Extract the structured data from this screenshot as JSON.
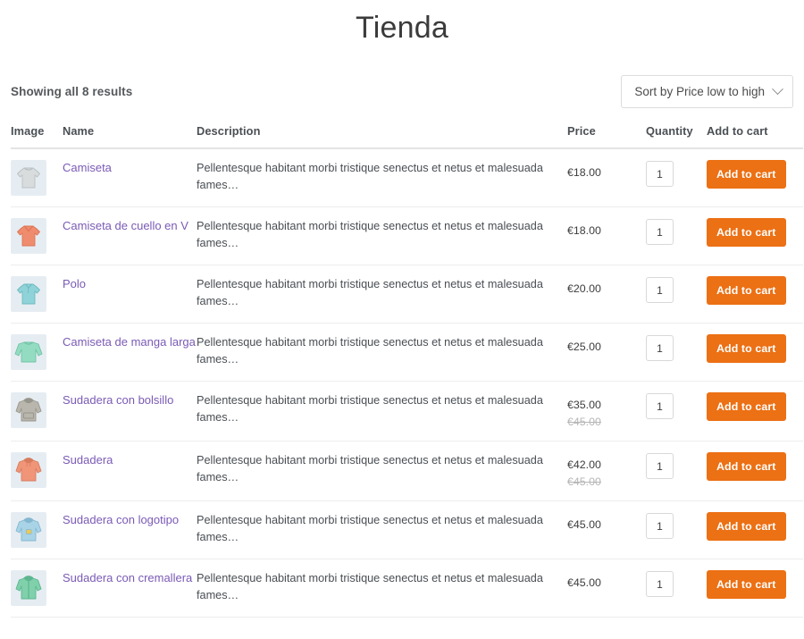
{
  "page": {
    "title": "Tienda"
  },
  "result_bar": {
    "count_text": "Showing all 8 results",
    "sort": {
      "label": "Sort by Price low to high",
      "chevron_icon": "chevron-down-icon"
    }
  },
  "table": {
    "headers": {
      "image": "Image",
      "name": "Name",
      "description": "Description",
      "price": "Price",
      "quantity": "Quantity",
      "add_to_cart": "Add to cart"
    },
    "add_to_cart_label": "Add to cart",
    "rows": [
      {
        "icon": "tshirt-icon",
        "name": "Camiseta",
        "description": "Pellentesque habitant morbi tristique senectus et netus et malesuada fames…",
        "price": "€18.00",
        "price_old": "",
        "quantity": "1",
        "add_to_cart": "Add to cart",
        "color": "#d8dcdd",
        "color_dark": "#b9c0c2"
      },
      {
        "icon": "vneck-tshirt-icon",
        "name": "Camiseta de cuello en V",
        "description": "Pellentesque habitant morbi tristique senectus et netus et malesuada fames…",
        "price": "€18.00",
        "price_old": "",
        "quantity": "1",
        "add_to_cart": "Add to cart",
        "color": "#f08c6e",
        "color_dark": "#d97554"
      },
      {
        "icon": "polo-shirt-icon",
        "name": "Polo",
        "description": "Pellentesque habitant morbi tristique senectus et netus et malesuada fames…",
        "price": "€20.00",
        "price_old": "",
        "quantity": "1",
        "add_to_cart": "Add to cart",
        "color": "#8fd3d8",
        "color_dark": "#6fb9c0"
      },
      {
        "icon": "long-sleeve-tee-icon",
        "name": "Camiseta de manga larga",
        "description": "Pellentesque habitant morbi tristique senectus et netus et malesuada fames…",
        "price": "€25.00",
        "price_old": "",
        "quantity": "1",
        "add_to_cart": "Add to cart",
        "color": "#93dcc2",
        "color_dark": "#72c2a6"
      },
      {
        "icon": "pocket-hoodie-icon",
        "name": "Sudadera con bolsillo",
        "description": "Pellentesque habitant morbi tristique senectus et netus et malesuada fames…",
        "price": "€35.00",
        "price_old": "€45.00",
        "quantity": "1",
        "add_to_cart": "Add to cart",
        "color": "#b9b7ad",
        "color_dark": "#98968c"
      },
      {
        "icon": "hoodie-icon",
        "name": "Sudadera",
        "description": "Pellentesque habitant morbi tristique senectus et netus et malesuada fames…",
        "price": "€42.00",
        "price_old": "€45.00",
        "quantity": "1",
        "add_to_cart": "Add to cart",
        "color": "#f09578",
        "color_dark": "#d87c5e"
      },
      {
        "icon": "logo-hoodie-icon",
        "name": "Sudadera con logotipo",
        "description": "Pellentesque habitant morbi tristique senectus et netus et malesuada fames…",
        "price": "€45.00",
        "price_old": "",
        "quantity": "1",
        "add_to_cart": "Add to cart",
        "color": "#a9d3e6",
        "color_dark": "#84b8d1"
      },
      {
        "icon": "zip-hoodie-icon",
        "name": "Sudadera con cremallera",
        "description": "Pellentesque habitant morbi tristique senectus et netus et malesuada fames…",
        "price": "€45.00",
        "price_old": "",
        "quantity": "1",
        "add_to_cart": "Add to cart",
        "color": "#7fd0ab",
        "color_dark": "#5cb690"
      }
    ]
  },
  "colors": {
    "accent": "#ec7014",
    "link": "#7a5ab5",
    "thumb_bg": "#e6edf2",
    "text": "#3c434a",
    "muted": "#b6b6b6"
  }
}
